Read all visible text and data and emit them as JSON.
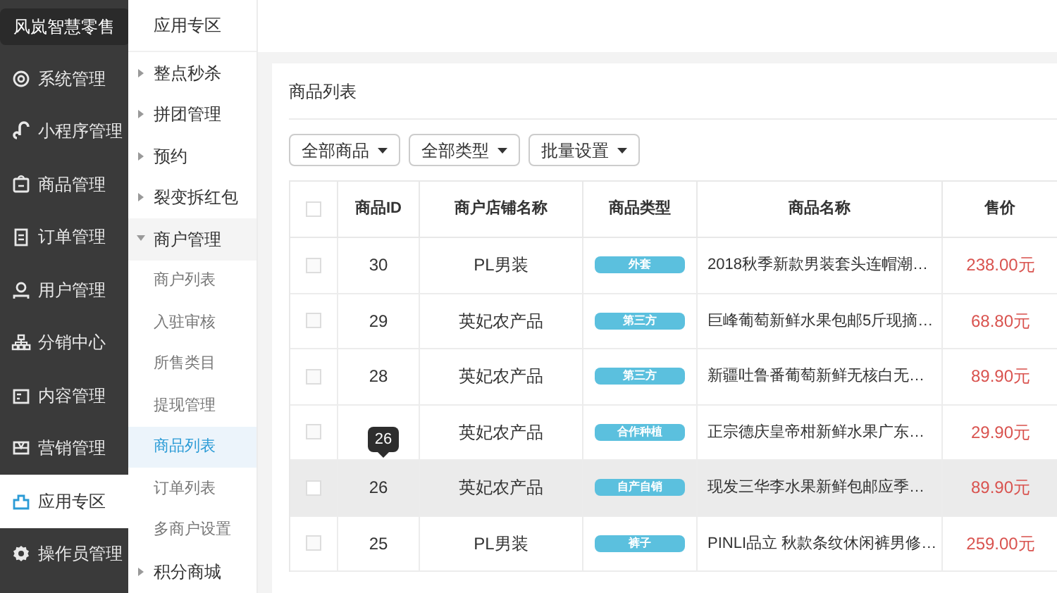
{
  "brand": "风岚智慧零售",
  "main_nav": [
    {
      "label": "系统管理",
      "selected": false
    },
    {
      "label": "小程序管理",
      "selected": false
    },
    {
      "label": "商品管理",
      "selected": false
    },
    {
      "label": "订单管理",
      "selected": false
    },
    {
      "label": "用户管理",
      "selected": false
    },
    {
      "label": "分销中心",
      "selected": false
    },
    {
      "label": "内容管理",
      "selected": false
    },
    {
      "label": "营销管理",
      "selected": false
    },
    {
      "label": "应用专区",
      "selected": true
    },
    {
      "label": "操作员管理",
      "selected": false
    }
  ],
  "sub_nav": {
    "title": "应用专区",
    "items": [
      {
        "label": "整点秒杀",
        "expanded": false
      },
      {
        "label": "拼团管理",
        "expanded": false
      },
      {
        "label": "预约",
        "expanded": false
      },
      {
        "label": "裂变拆红包",
        "expanded": false
      },
      {
        "label": "商户管理",
        "expanded": true,
        "children": [
          {
            "label": "商户列表",
            "selected": false
          },
          {
            "label": "入驻审核",
            "selected": false
          },
          {
            "label": "所售类目",
            "selected": false
          },
          {
            "label": "提现管理",
            "selected": false
          },
          {
            "label": "商品列表",
            "selected": true
          },
          {
            "label": "订单列表",
            "selected": false
          },
          {
            "label": "多商户设置",
            "selected": false
          }
        ]
      },
      {
        "label": "积分商城",
        "expanded": false
      }
    ]
  },
  "panel": {
    "title": "商品列表",
    "filters": [
      "全部商品",
      "全部类型",
      "批量设置"
    ],
    "table": {
      "header_checked": false,
      "columns": [
        "商品ID",
        "商户店铺名称",
        "商品类型",
        "商品名称",
        "售价"
      ],
      "rows": [
        {
          "checked": false,
          "highlighted": false,
          "id": "30",
          "store": "PL男装",
          "type": "外套",
          "name": "2018秋季新款男装套头连帽潮…",
          "price": "238.00元"
        },
        {
          "checked": false,
          "highlighted": false,
          "id": "29",
          "store": "英妃农产品",
          "type": "第三方",
          "name": "巨峰葡萄新鲜水果包邮5斤现摘…",
          "price": "68.80元"
        },
        {
          "checked": false,
          "highlighted": false,
          "id": "28",
          "store": "英妃农产品",
          "type": "第三方",
          "name": "新疆吐鲁番葡萄新鲜无核白无…",
          "price": "89.90元"
        },
        {
          "checked": false,
          "highlighted": false,
          "store": "英妃农产品",
          "type": "合作种植",
          "name": "正宗德庆皇帝柑新鲜水果广东…",
          "price": "29.90元"
        },
        {
          "checked": false,
          "highlighted": true,
          "id": "26",
          "store": "英妃农产品",
          "type": "自产自销",
          "name": "现发三华李水果新鲜包邮应季…",
          "price": "89.90元"
        },
        {
          "checked": false,
          "highlighted": false,
          "id": "25",
          "store": "PL男装",
          "type": "裤子",
          "name": "PINLI品立 秋款条纹休闲裤男修…",
          "price": "259.00元"
        }
      ]
    },
    "tooltip": "26"
  }
}
